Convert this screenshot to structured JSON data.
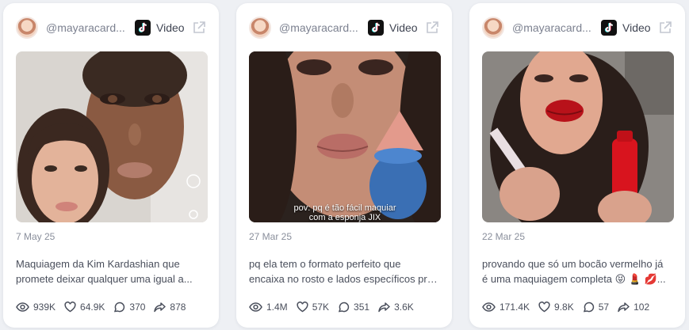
{
  "posts": [
    {
      "handle": "@mayaracard...",
      "platform": "Video",
      "date": "7 May 25",
      "description": [
        "Maquiagem da Kim Kardashian que",
        "promete deixar qualquer uma igual a..."
      ],
      "overlay_text": [
        "",
        ""
      ],
      "stats": {
        "views": "939K",
        "likes": "64.9K",
        "comments": "370",
        "shares": "878"
      }
    },
    {
      "handle": "@mayaracard...",
      "platform": "Video",
      "date": "27 Mar 25",
      "description": [
        "pq ela tem o formato perfeito que",
        "encaixa no rosto e lados específicos pra..."
      ],
      "overlay_text": [
        "pov: pq é tão fácil maquiar",
        "com a esponja JIX"
      ],
      "stats": {
        "views": "1.4M",
        "likes": "57K",
        "comments": "351",
        "shares": "3.6K"
      }
    },
    {
      "handle": "@mayaracard...",
      "platform": "Video",
      "date": "22 Mar 25",
      "description": [
        "provando que só um bocão vermelho já",
        "é uma maquiagem completa 😝 💄 💋..."
      ],
      "overlay_text": [
        "",
        ""
      ],
      "stats": {
        "views": "171.4K",
        "likes": "9.8K",
        "comments": "57",
        "shares": "102"
      }
    }
  ],
  "icons": {
    "platform": "tiktok-icon",
    "external": "external-link-icon",
    "views": "eye-icon",
    "likes": "heart-icon",
    "comments": "comment-icon",
    "shares": "share-icon"
  },
  "colors": {
    "page_bg": "#eef0f4",
    "card_bg": "#ffffff",
    "muted_text": "#8a8f9c",
    "body_text": "#4a4f5c"
  }
}
